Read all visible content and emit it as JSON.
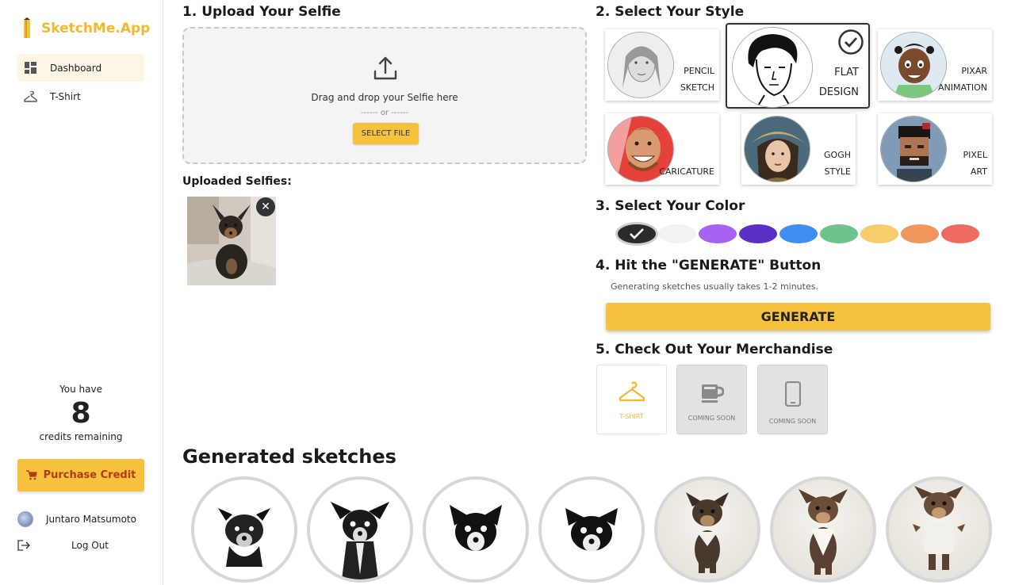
{
  "brand": {
    "name": "SketchMe.App",
    "accent": "#f3b92c"
  },
  "sidebar": {
    "items": [
      {
        "label": "Dashboard",
        "icon": "dashboard-icon",
        "active": true
      },
      {
        "label": "T-Shirt",
        "icon": "hanger-icon",
        "active": false
      }
    ],
    "credits": {
      "prefix": "You have",
      "count": "8",
      "suffix": "credits remaining"
    },
    "purchase_label": "Purchase Credit",
    "user_name": "Juntaro Matsumoto",
    "logout_label": "Log Out"
  },
  "upload": {
    "title": "1. Upload Your Selfie",
    "drag_text": "Drag and drop your Selfie here",
    "or_text": "------ or ------",
    "select_label": "SELECT FILE",
    "uploaded_title": "Uploaded Selfies:"
  },
  "styles": {
    "title": "2. Select Your Style",
    "selected": "FLAT DESIGN",
    "items": [
      {
        "line1": "PENCIL",
        "line2": "SKETCH"
      },
      {
        "line1": "FLAT",
        "line2": "DESIGN"
      },
      {
        "line1": "PIXAR",
        "line2": "ANIMATION"
      },
      {
        "line1": "",
        "line2": "CARICATURE"
      },
      {
        "line1": "GOGH",
        "line2": "STYLE"
      },
      {
        "line1": "PIXEL",
        "line2": "ART"
      }
    ]
  },
  "colors": {
    "title": "3. Select Your Color",
    "selected_index": 0,
    "swatches": [
      "#2b2b2b",
      "#f2f2f2",
      "#a862f2",
      "#5b2fc4",
      "#3f8ef2",
      "#6cc48c",
      "#f7cd6b",
      "#f1975b",
      "#ef6b62"
    ]
  },
  "generate": {
    "title": "4. Hit the \"GENERATE\" Button",
    "note": "Generating sketches usually takes 1-2 minutes.",
    "button_label": "GENERATE"
  },
  "merch": {
    "title": "5. Check Out Your Merchandise",
    "items": [
      {
        "label": "T-SHIRT",
        "icon": "hanger-icon",
        "enabled": true
      },
      {
        "label": "COMING SOON",
        "icon": "mug-icon",
        "enabled": false
      },
      {
        "label": "COMING SOON",
        "icon": "phone-icon",
        "enabled": false
      }
    ]
  },
  "generated": {
    "title": "Generated sketches"
  }
}
